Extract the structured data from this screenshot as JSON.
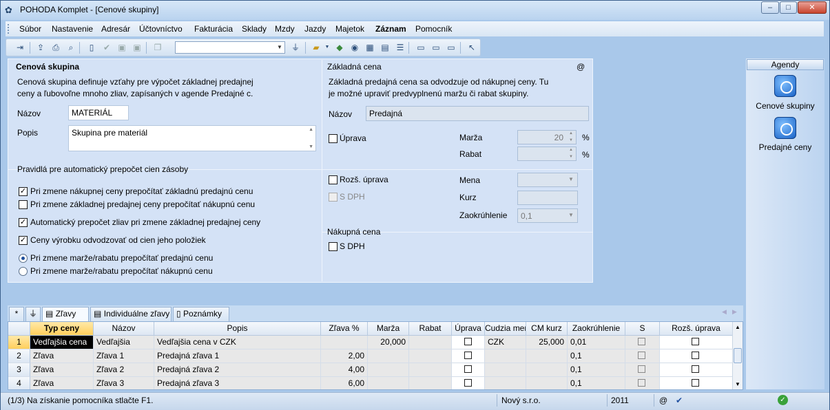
{
  "window": {
    "title": "POHODA Komplet - [Cenové skupiny]"
  },
  "menu": [
    "Súbor",
    "Nastavenie",
    "Adresár",
    "Účtovníctvo",
    "Fakturácia",
    "Sklady",
    "Mzdy",
    "Jazdy",
    "Majetok",
    "Záznam",
    "Pomocník"
  ],
  "toolbar": {
    "icons": [
      "exit-icon",
      "import-icon",
      "print-icon",
      "print-preview-icon",
      "new-record-icon",
      "check-icon",
      "save-icon",
      "save-all-icon",
      "copy-icon",
      "filter-icon",
      "folder-icon",
      "stamp-icon",
      "internet-icon",
      "calculator-icon",
      "calendar-icon",
      "list-icon",
      "window-icon",
      "card-icon",
      "help-pointer-icon"
    ],
    "combo_value": ""
  },
  "cenova_skupina": {
    "title": "Cenová skupina",
    "description": "Cenová skupina definuje vzťahy pre výpočet základnej predajnej ceny a ľubovoľne mnoho zliav, zapísaných v agende Predajné c.",
    "nazov_label": "Názov",
    "nazov_value": "MATERIÁL",
    "popis_label": "Popis",
    "popis_value": "Skupina pre materiál"
  },
  "pravidla": {
    "title": "Pravidlá pre automatický prepočet cien zásoby",
    "checks": [
      {
        "label": "Pri zmene nákupnej ceny prepočítať základnú predajnú cenu",
        "checked": true
      },
      {
        "label": "Pri zmene základnej predajnej ceny prepočítať nákupnú cenu",
        "checked": false
      },
      {
        "label": "Automatický prepočet zliav pri zmene základnej predajnej ceny",
        "checked": true
      },
      {
        "label": "Ceny výrobku odvodzovať od cien jeho položiek",
        "checked": true
      }
    ],
    "radios": [
      {
        "label": "Pri zmene marže/rabatu prepočítať predajnú cenu",
        "selected": true
      },
      {
        "label": "Pri zmene marže/rabatu prepočítať nákupnú cenu",
        "selected": false
      }
    ]
  },
  "zakladna_cena": {
    "title": "Základná cena",
    "at_sign": "@",
    "description": "Základná predajná cena sa odvodzuje od nákupnej ceny. Tu je možné upraviť predvyplnenú maržu či rabat skupiny.",
    "nazov_label": "Názov",
    "nazov_value": "Predajná",
    "uprava_label": "Úprava",
    "marza_label": "Marža",
    "marza_value": "20",
    "rabat_label": "Rabat",
    "rabat_value": "",
    "percent": "%",
    "rozs_uprava_label": "Rozš. úprava",
    "s_dph_label": "S DPH",
    "mena_label": "Mena",
    "mena_value": "",
    "kurz_label": "Kurz",
    "kurz_value": "",
    "zaokruhlenie_label": "Zaokrúhlenie",
    "zaokruhlenie_value": "0,1"
  },
  "nakupna_cena": {
    "title": "Nákupná cena",
    "s_dph_label": "S DPH"
  },
  "agenda": {
    "header": "Agendy",
    "items": [
      "Cenové skupiny",
      "Predajné ceny"
    ]
  },
  "tabs": [
    "Zľavy",
    "Individuálne zľavy",
    "Poznámky"
  ],
  "grid": {
    "columns": [
      "Typ ceny",
      "Názov",
      "Popis",
      "Zľava %",
      "Marža",
      "Rabat",
      "Úprava",
      "Cudzia mena",
      "CM kurz",
      "Zaokrúhlenie",
      "S",
      "Rozš. úprava"
    ],
    "rows": [
      {
        "num": "1",
        "typ": "Vedľajšia cena",
        "nazov": "Vedľajšia",
        "popis": "Vedľajšia cena v CZK",
        "zlava": "",
        "marza": "20,000",
        "rabat": "",
        "cm": "CZK",
        "kurz": "25,000",
        "zaokr": "0,01"
      },
      {
        "num": "2",
        "typ": "Zľava",
        "nazov": "Zľava 1",
        "popis": "Predajná zľava 1",
        "zlava": "2,00",
        "marza": "",
        "rabat": "",
        "cm": "",
        "kurz": "",
        "zaokr": "0,1"
      },
      {
        "num": "3",
        "typ": "Zľava",
        "nazov": "Zľava 2",
        "popis": "Predajná zľava 2",
        "zlava": "4,00",
        "marza": "",
        "rabat": "",
        "cm": "",
        "kurz": "",
        "zaokr": "0,1"
      },
      {
        "num": "4",
        "typ": "Zľava",
        "nazov": "Zľava 3",
        "popis": "Predajná zľava 3",
        "zlava": "6,00",
        "marza": "",
        "rabat": "",
        "cm": "",
        "kurz": "",
        "zaokr": "0,1"
      }
    ]
  },
  "status": {
    "hint": "(1/3) Na získanie pomocníka stlačte F1.",
    "company": "Nový s.r.o.",
    "year": "2011",
    "at": "@"
  }
}
